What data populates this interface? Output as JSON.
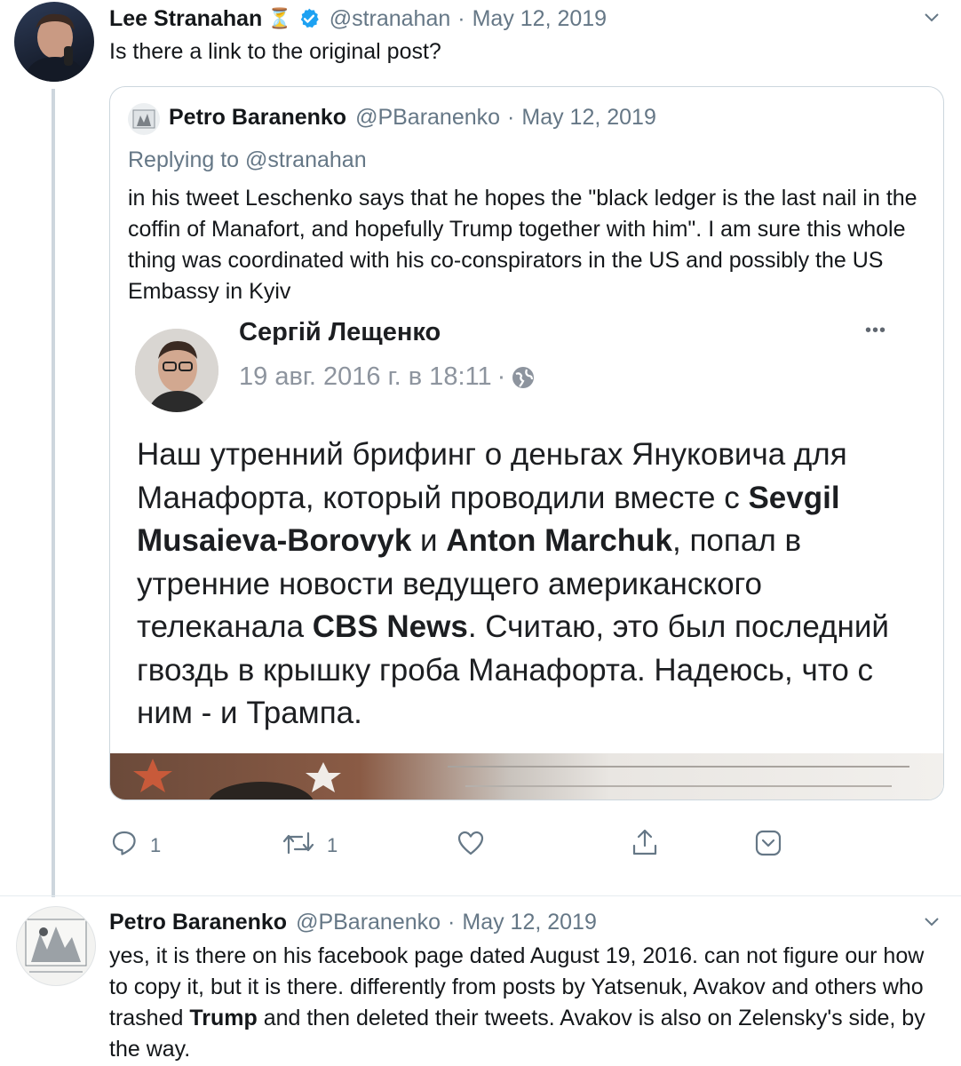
{
  "tweet1": {
    "author": "Lee Stranahan",
    "hourglass": "⏳",
    "handle": "@stranahan",
    "sep": "·",
    "date": "May 12, 2019",
    "text": "Is there a link to the original post?",
    "icons": {
      "verified": "verified-badge-icon",
      "menu": "chevron-down-icon"
    },
    "quoted": {
      "author": "Petro Baranenko",
      "handle": "@PBaranenko",
      "sep": "·",
      "date": "May 12, 2019",
      "replying_prefix": "Replying to",
      "replying_to": "@stranahan",
      "text": "in his tweet Leschenko says that he hopes the \"black ledger is the last nail in the coffin of Manafort, and hopefully Trump together with him\". I am sure this whole thing was coordinated with his co-conspirators in the US and possibly the US Embassy in Kyiv",
      "fb_post": {
        "name": "Сергій Лещенко",
        "time": "19 авг. 2016 г. в 18:11",
        "dot": "·",
        "more": "•••",
        "text": {
          "p1": "Наш утренний брифинг о деньгах Януковича для Манафорта, который проводили вместе с ",
          "b1": "Sevgil Musaieva-Borovyk",
          "p2": " и ",
          "b2": "Anton Marchuk",
          "p3": ", попал в утренние новости ведущего американского телеканала ",
          "b3": "CBS News",
          "p4": ". Считаю, это был последний гвоздь в крышку гроба Манафорта. Надеюсь, что с ним - и Трампа."
        }
      }
    },
    "actions": {
      "reply_count": "1",
      "retweet_count": "1"
    }
  },
  "tweet2": {
    "author": "Petro Baranenko",
    "handle": "@PBaranenko",
    "sep": "·",
    "date": "May 12, 2019",
    "text_a": "yes, it is there on his facebook page dated August 19, 2016. can not figure our how to copy it, but it is there. differently from posts by Yatsenuk, Avakov and others who trashed ",
    "text_bold": "Trump",
    "text_b": " and then deleted their tweets. Avakov is also on Zelensky's side, by the way."
  },
  "colors": {
    "muted": "#657786",
    "border": "#ccd6dd",
    "verified": "#1da1f2",
    "hourglass": "#f5a623"
  }
}
